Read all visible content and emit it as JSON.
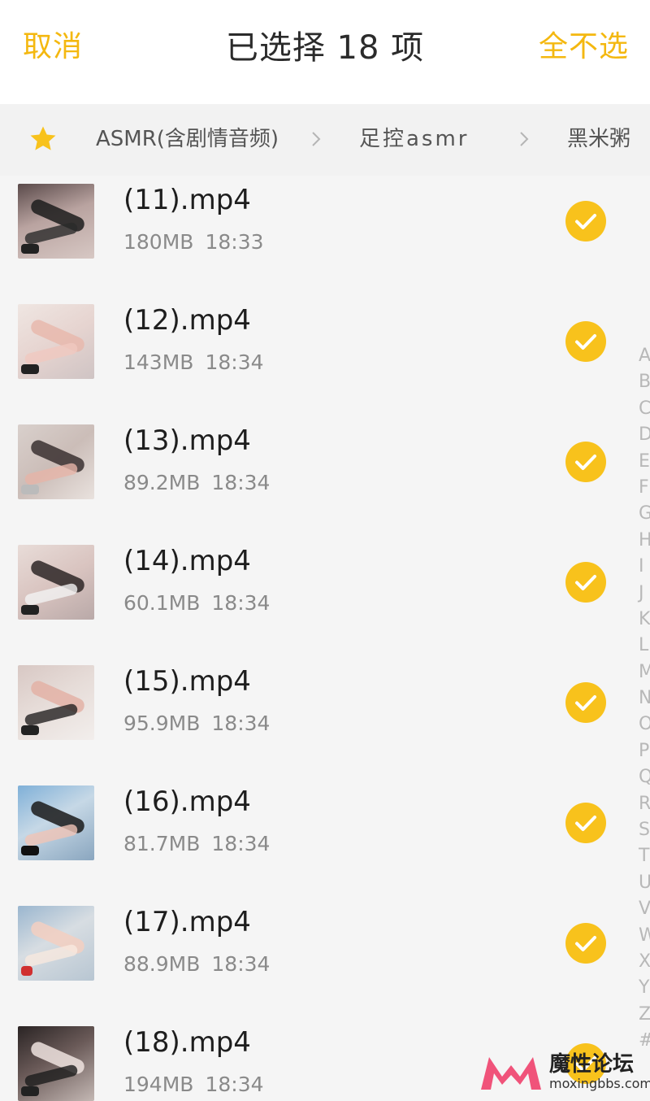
{
  "header": {
    "cancel_label": "取消",
    "title": "已选择 18 项",
    "deselect_all_label": "全不选"
  },
  "breadcrumb": {
    "items": [
      "ASMR(含剧情音频)",
      "足控asmr",
      "黑米粥"
    ]
  },
  "files": [
    {
      "name": "(11).mp4",
      "size": "180MB",
      "time": "18:33",
      "selected": true
    },
    {
      "name": "(12).mp4",
      "size": "143MB",
      "time": "18:34",
      "selected": true
    },
    {
      "name": "(13).mp4",
      "size": "89.2MB",
      "time": "18:34",
      "selected": true
    },
    {
      "name": "(14).mp4",
      "size": "60.1MB",
      "time": "18:34",
      "selected": true
    },
    {
      "name": "(15).mp4",
      "size": "95.9MB",
      "time": "18:34",
      "selected": true
    },
    {
      "name": "(16).mp4",
      "size": "81.7MB",
      "time": "18:34",
      "selected": true
    },
    {
      "name": "(17).mp4",
      "size": "88.9MB",
      "time": "18:34",
      "selected": true
    },
    {
      "name": "(18).mp4",
      "size": "194MB",
      "time": "18:34",
      "selected": true
    }
  ],
  "index_letters": [
    "A",
    "B",
    "C",
    "D",
    "E",
    "F",
    "G",
    "H",
    "I",
    "J",
    "K",
    "L",
    "M",
    "N",
    "O",
    "P",
    "Q",
    "R",
    "S",
    "T",
    "U",
    "V",
    "W",
    "X",
    "Y",
    "Z",
    "#"
  ],
  "watermark": {
    "name": "魔性论坛",
    "url": "moxingbbs.com"
  },
  "colors": {
    "accent": "#f4b810",
    "check_fill": "#f8c21c",
    "text_primary": "#1e1e1e",
    "text_secondary": "#8a8a8a",
    "watermark_pink": "#f0537a"
  },
  "icons": {
    "breadcrumb_root": "star-icon",
    "breadcrumb_separator": "chevron-right-icon",
    "selected_state": "checkmark-circle-icon"
  }
}
